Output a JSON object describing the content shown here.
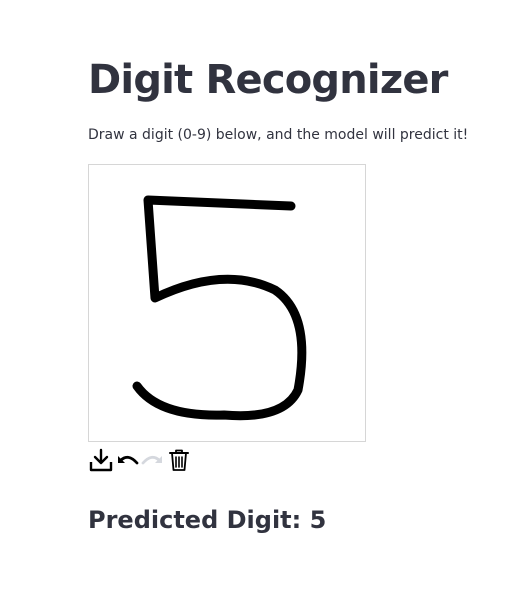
{
  "page": {
    "title": "Digit Recognizer",
    "instructions": "Draw a digit (0-9) below, and the model will predict it!"
  },
  "canvas": {
    "stroke_color": "#000000",
    "background_color": "#ffffff",
    "drawn_digit": "5"
  },
  "toolbar": {
    "buttons": [
      {
        "icon": "download-icon",
        "enabled": true
      },
      {
        "icon": "undo-icon",
        "enabled": true
      },
      {
        "icon": "redo-icon",
        "enabled": false
      },
      {
        "icon": "trash-icon",
        "enabled": true
      }
    ]
  },
  "result": {
    "prediction_text": "Predicted Digit: 5"
  }
}
